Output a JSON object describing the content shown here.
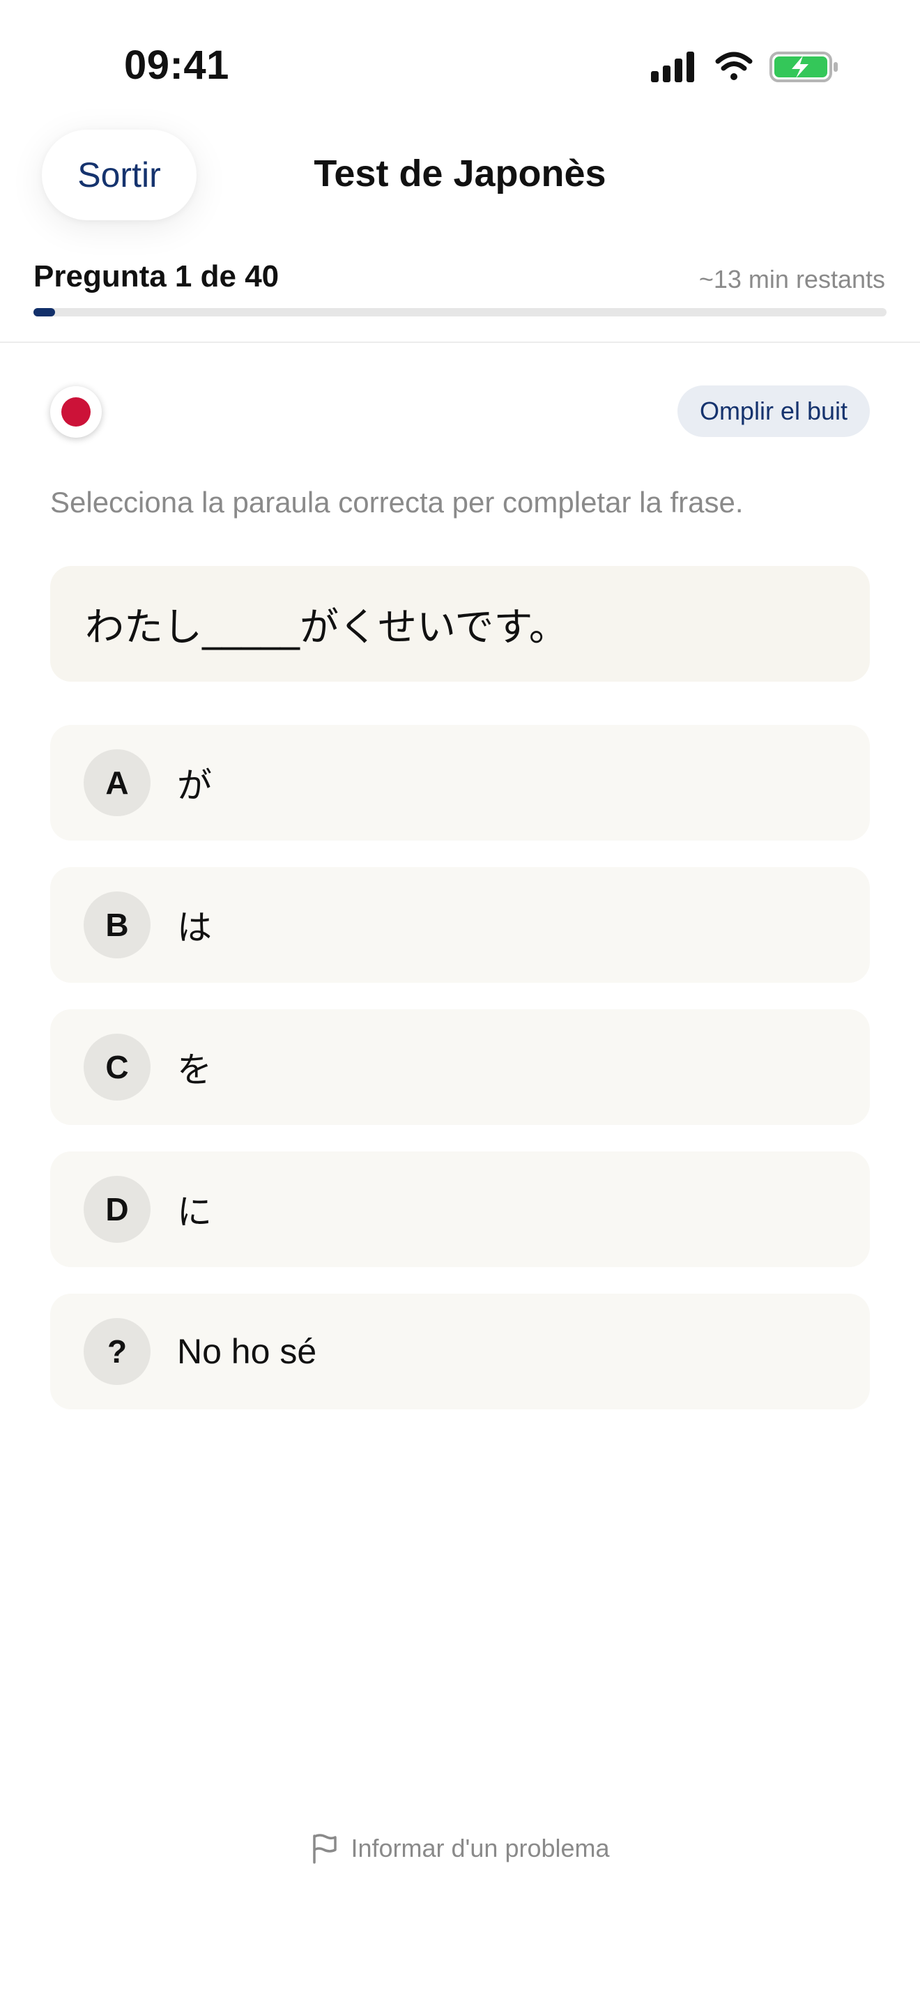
{
  "status_bar": {
    "time": "09:41"
  },
  "header": {
    "exit_label": "Sortir",
    "title": "Test de Japonès"
  },
  "progress": {
    "counter_label": "Pregunta 1 de 40",
    "time_remaining": "~13 min restants",
    "current": 1,
    "total": 40
  },
  "question": {
    "flag_icon": "japan-flag-icon",
    "type_badge": "Omplir el buit",
    "instruction": "Selecciona la paraula correcta per completar la frase.",
    "sentence": "わたし_____がくせいです。"
  },
  "options": [
    {
      "letter": "A",
      "text": "が"
    },
    {
      "letter": "B",
      "text": "は"
    },
    {
      "letter": "C",
      "text": "を"
    },
    {
      "letter": "D",
      "text": "に"
    },
    {
      "letter": "?",
      "text": "No ho sé"
    }
  ],
  "footer": {
    "report_label": "Informar d'un problema",
    "report_icon": "flag-outline-icon"
  },
  "colors": {
    "accent": "#15336e",
    "progress_fill": "#12306a",
    "flag_red": "#cc1238",
    "battery_green": "#34c759"
  }
}
